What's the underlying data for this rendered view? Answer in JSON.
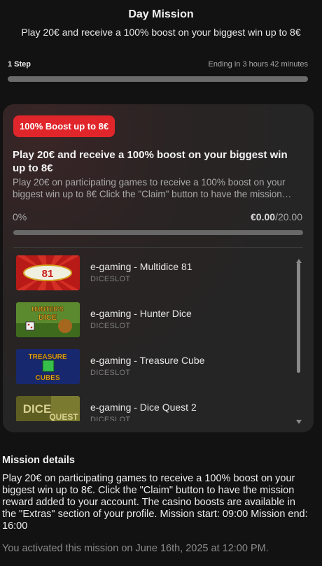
{
  "header": {
    "title": "Day Mission",
    "subtitle": "Play 20€ and receive a 100% boost on your biggest win up to 8€"
  },
  "step": {
    "label": "1 Step",
    "ending": "Ending in 3 hours 42 minutes",
    "progress_fraction": 0.0
  },
  "card": {
    "badge": "100% Boost up to 8€",
    "title": "Play 20€ and receive a 100% boost on your biggest win up to 8€",
    "description": "Play 20€ on participating games to receive a 100% boost on your biggest win up to 8€ Click the \"Claim\" button to have the mission reward added to your account.",
    "percent": "0%",
    "amount_current": "€0.00",
    "amount_target": "/20.00",
    "progress_fraction": 0.0
  },
  "games": [
    {
      "name": "e-gaming - Multidice 81",
      "provider": "DICESLOT",
      "thumb_text": "81",
      "thumb_color": "#c8201c"
    },
    {
      "name": "e-gaming - Hunter Dice",
      "provider": "DICESLOT",
      "thumb_text": "HUNTER'S DICE",
      "thumb_color": "#4a7a2a"
    },
    {
      "name": "e-gaming - Treasure Cube",
      "provider": "DICESLOT",
      "thumb_text": "TREASURE CUBES",
      "thumb_color": "#1b2f7a"
    },
    {
      "name": "e-gaming - Dice Quest 2",
      "provider": "DICESLOT",
      "thumb_text": "DICE QUEST",
      "thumb_color": "#6d6b2a"
    }
  ],
  "details": {
    "title": "Mission details",
    "text": "Play 20€ on participating games to receive a 100% boost on your biggest win up to 8€. Click the \"Claim\" button to have the mission reward added to your account. The casino boosts are available in the \"Extras\" section of your profile. Mission start: 09:00 Mission end: 16:00",
    "activated": "You activated this mission on June 16th, 2025 at 12:00 PM."
  },
  "colors": {
    "accent": "#e0262b",
    "background": "#121212",
    "card": "#252525"
  }
}
